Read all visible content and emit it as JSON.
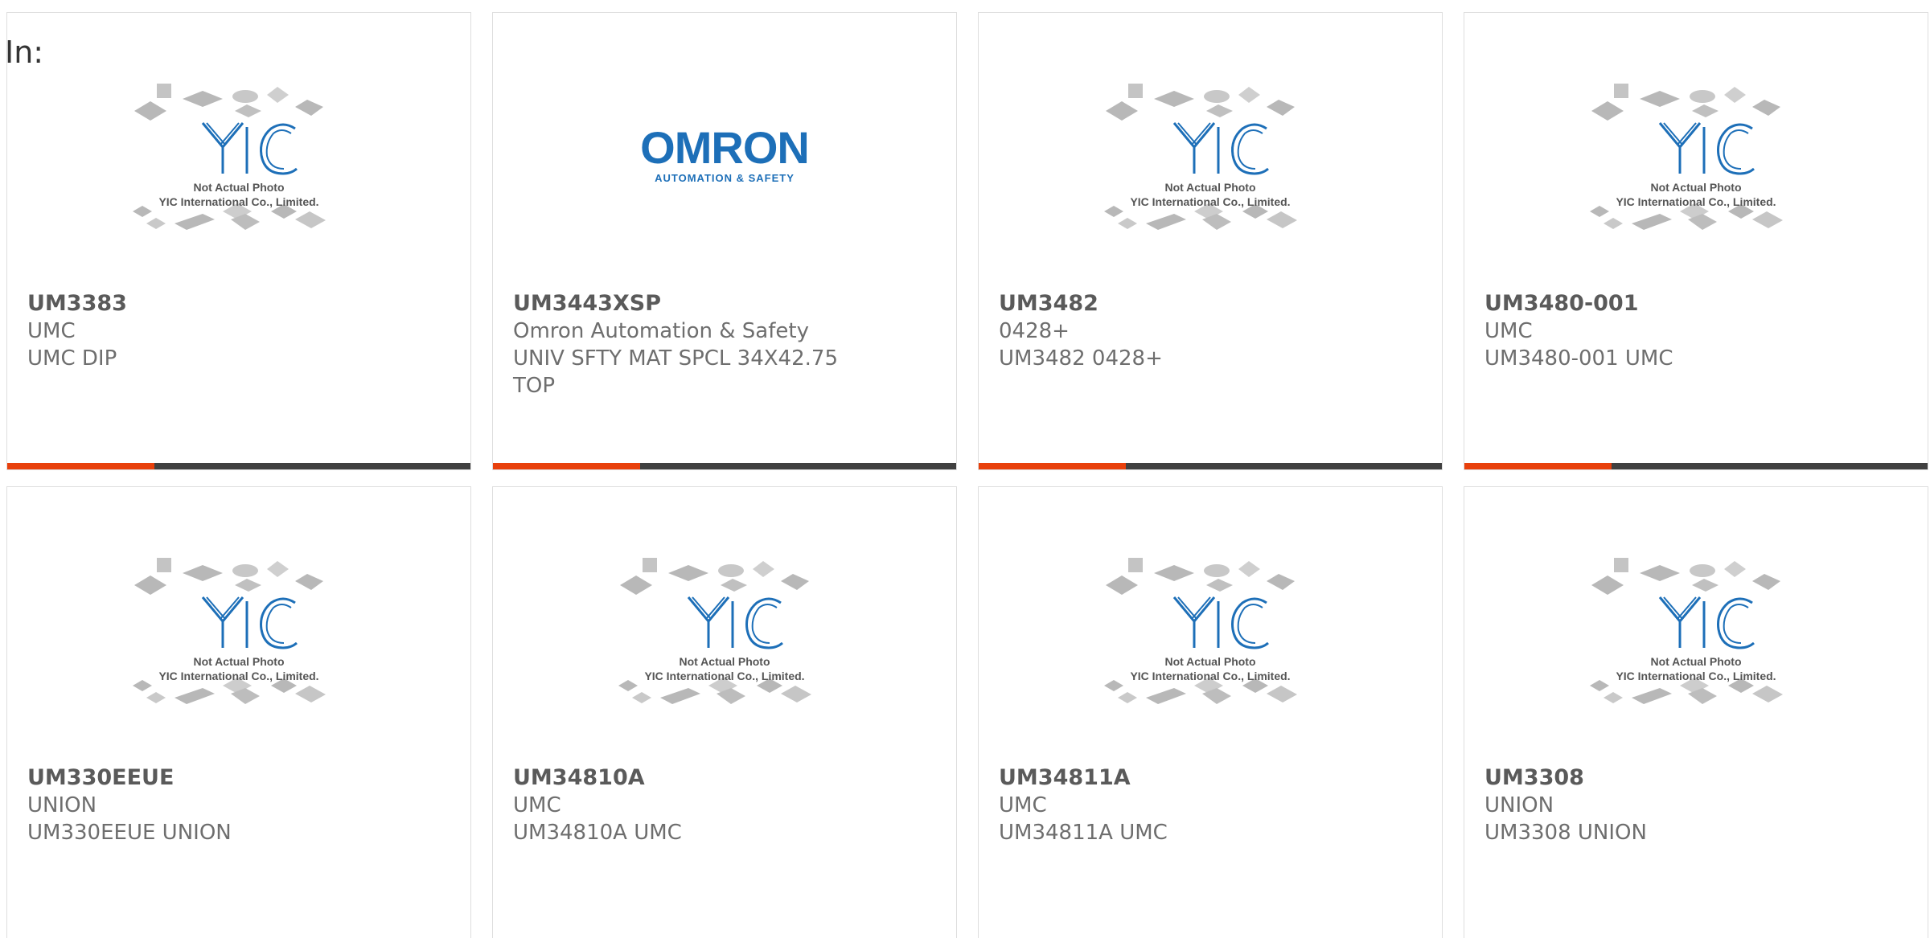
{
  "header": {
    "label": "In:"
  },
  "colors": {
    "accent": "#e8400c",
    "bar": "#404040",
    "logo_blue": "#1d6fb8"
  },
  "placeholder": {
    "caption_line1": "Not Actual Photo",
    "caption_line2": "YIC International Co., Limited.",
    "logo_text": "YIC"
  },
  "omron_logo": {
    "brand": "OMRON",
    "tagline": "AUTOMATION & SAFETY"
  },
  "products": [
    {
      "part": "UM3383",
      "maker": "UMC",
      "desc": "UMC DIP",
      "image": "placeholder"
    },
    {
      "part": "UM3443XSP",
      "maker": "Omron Automation & Safety",
      "desc": "UNIV SFTY MAT SPCL 34X42.75 TOP",
      "image": "omron-logo"
    },
    {
      "part": "UM3482",
      "maker": "0428+",
      "desc": "UM3482 0428+",
      "image": "placeholder"
    },
    {
      "part": "UM3480-001",
      "maker": "UMC",
      "desc": "UM3480-001 UMC",
      "image": "placeholder"
    },
    {
      "part": "UM330EEUE",
      "maker": "UNION",
      "desc": "UM330EEUE UNION",
      "image": "placeholder"
    },
    {
      "part": "UM34810A",
      "maker": "UMC",
      "desc": "UM34810A UMC",
      "image": "placeholder"
    },
    {
      "part": "UM34811A",
      "maker": "UMC",
      "desc": "UM34811A UMC",
      "image": "placeholder"
    },
    {
      "part": "UM3308",
      "maker": "UNION",
      "desc": "UM3308 UNION",
      "image": "placeholder"
    }
  ]
}
